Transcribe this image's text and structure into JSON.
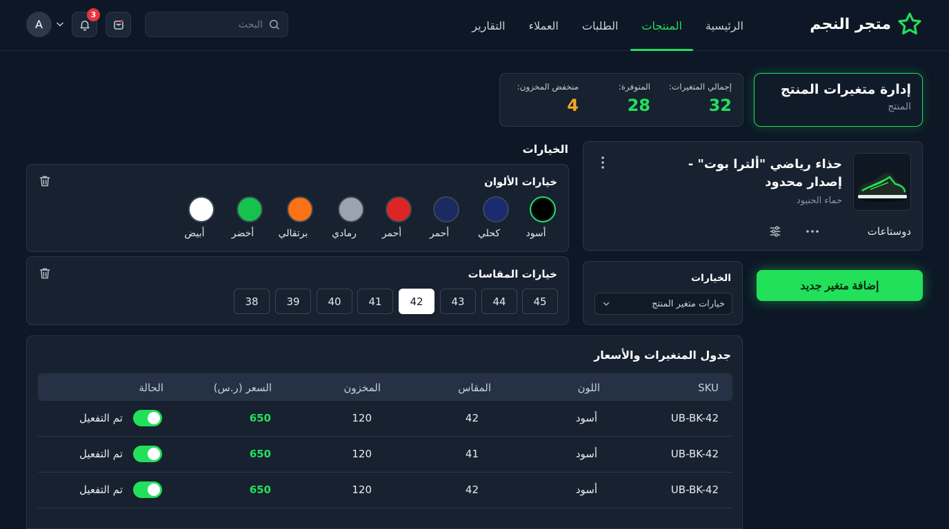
{
  "brand": {
    "name": "متجر النجم",
    "accent": "#22e05a"
  },
  "nav": [
    "الرئيسية",
    "المنتجات",
    "الطلبات",
    "العملاء",
    "التقارير"
  ],
  "nav_active": "المنتجات",
  "search": {
    "placeholder": "البحث"
  },
  "notifications": {
    "count": "3"
  },
  "user": {
    "initial": "A"
  },
  "page": {
    "title": "إدارة متغيرات المنتج",
    "subtitle": "المنتج"
  },
  "stats": [
    {
      "label": "إجمالي المتغيرات:",
      "value": "32",
      "color": "#22e05a"
    },
    {
      "label": "المتوفرة:",
      "value": "28",
      "color": "#22e05a"
    },
    {
      "label": "منخفض المخزون:",
      "value": "4",
      "color": "#f5a623"
    }
  ],
  "product": {
    "name": "حذاء رياضي \"ألترا بوت\" - إصدار محدود",
    "brand": "حماء الحنيود",
    "category": "دوستاعات"
  },
  "variant_selector": {
    "label": "الخيارات",
    "value": "خيارات متغير المنتج"
  },
  "add_button": "إضافة متغير جديد",
  "options": {
    "title": "الخيارات",
    "colors_title": "خيارات الألوان",
    "colors": [
      {
        "label": "أسود",
        "hex": "#000000",
        "selected": true
      },
      {
        "label": "كحلي",
        "hex": "#1a2a6e"
      },
      {
        "label": "أحمر",
        "hex": "#1b2a63"
      },
      {
        "label": "أحمر",
        "hex": "#dc2626"
      },
      {
        "label": "رمادي",
        "hex": "#9ca3af"
      },
      {
        "label": "برتقالي",
        "hex": "#f97316"
      },
      {
        "label": "أخضر",
        "hex": "#16c24c"
      },
      {
        "label": "أبيض",
        "hex": "#ffffff"
      }
    ],
    "sizes_title": "خيارات المقاسات",
    "sizes": [
      "45",
      "44",
      "43",
      "42",
      "41",
      "40",
      "39",
      "38"
    ],
    "selected_size": "42"
  },
  "table": {
    "title": "جدول المتغيرات والأسعار",
    "headers": [
      "SKU",
      "اللون",
      "المقاس",
      "المخزون",
      "السعر (ر.س)",
      "الحالة"
    ],
    "rows": [
      {
        "sku": "UB-BK-42",
        "color": "أسود",
        "size": "42",
        "stock": "120",
        "price": "650",
        "status": "تم التفعيل"
      },
      {
        "sku": "UB-BK-42",
        "color": "أسود",
        "size": "41",
        "stock": "120",
        "price": "650",
        "status": "تم التفعيل"
      },
      {
        "sku": "UB-BK-42",
        "color": "أسود",
        "size": "42",
        "stock": "120",
        "price": "650",
        "status": "تم التفعيل"
      }
    ]
  }
}
